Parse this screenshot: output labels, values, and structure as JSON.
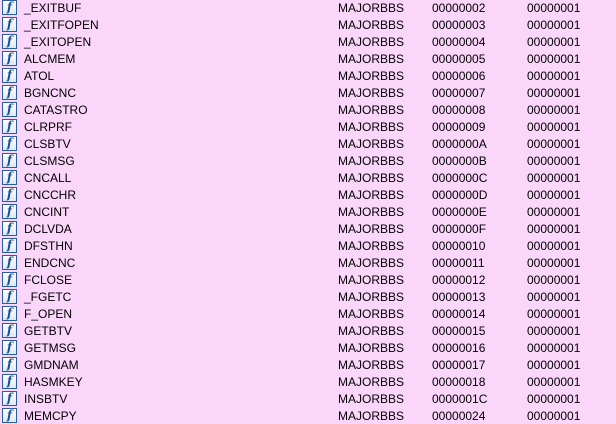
{
  "icon": {
    "name": "function-icon",
    "glyph": "f",
    "color": "#1f4f8f"
  },
  "rows": [
    {
      "name": "_EXITBUF",
      "module": "MAJORBBS",
      "ordinal": "00000002",
      "value": "00000001"
    },
    {
      "name": "_EXITFOPEN",
      "module": "MAJORBBS",
      "ordinal": "00000003",
      "value": "00000001"
    },
    {
      "name": "_EXITOPEN",
      "module": "MAJORBBS",
      "ordinal": "00000004",
      "value": "00000001"
    },
    {
      "name": "ALCMEM",
      "module": "MAJORBBS",
      "ordinal": "00000005",
      "value": "00000001"
    },
    {
      "name": "ATOL",
      "module": "MAJORBBS",
      "ordinal": "00000006",
      "value": "00000001"
    },
    {
      "name": "BGNCNC",
      "module": "MAJORBBS",
      "ordinal": "00000007",
      "value": "00000001"
    },
    {
      "name": "CATASTRO",
      "module": "MAJORBBS",
      "ordinal": "00000008",
      "value": "00000001"
    },
    {
      "name": "CLRPRF",
      "module": "MAJORBBS",
      "ordinal": "00000009",
      "value": "00000001"
    },
    {
      "name": "CLSBTV",
      "module": "MAJORBBS",
      "ordinal": "0000000A",
      "value": "00000001"
    },
    {
      "name": "CLSMSG",
      "module": "MAJORBBS",
      "ordinal": "0000000B",
      "value": "00000001"
    },
    {
      "name": "CNCALL",
      "module": "MAJORBBS",
      "ordinal": "0000000C",
      "value": "00000001"
    },
    {
      "name": "CNCCHR",
      "module": "MAJORBBS",
      "ordinal": "0000000D",
      "value": "00000001"
    },
    {
      "name": "CNCINT",
      "module": "MAJORBBS",
      "ordinal": "0000000E",
      "value": "00000001"
    },
    {
      "name": "DCLVDA",
      "module": "MAJORBBS",
      "ordinal": "0000000F",
      "value": "00000001"
    },
    {
      "name": "DFSTHN",
      "module": "MAJORBBS",
      "ordinal": "00000010",
      "value": "00000001"
    },
    {
      "name": "ENDCNC",
      "module": "MAJORBBS",
      "ordinal": "00000011",
      "value": "00000001"
    },
    {
      "name": "FCLOSE",
      "module": "MAJORBBS",
      "ordinal": "00000012",
      "value": "00000001"
    },
    {
      "name": "_FGETC",
      "module": "MAJORBBS",
      "ordinal": "00000013",
      "value": "00000001"
    },
    {
      "name": "F_OPEN",
      "module": "MAJORBBS",
      "ordinal": "00000014",
      "value": "00000001"
    },
    {
      "name": "GETBTV",
      "module": "MAJORBBS",
      "ordinal": "00000015",
      "value": "00000001"
    },
    {
      "name": "GETMSG",
      "module": "MAJORBBS",
      "ordinal": "00000016",
      "value": "00000001"
    },
    {
      "name": "GMDNAM",
      "module": "MAJORBBS",
      "ordinal": "00000017",
      "value": "00000001"
    },
    {
      "name": "HASMKEY",
      "module": "MAJORBBS",
      "ordinal": "00000018",
      "value": "00000001"
    },
    {
      "name": "INSBTV",
      "module": "MAJORBBS",
      "ordinal": "0000001C",
      "value": "00000001"
    },
    {
      "name": "MEMCPY",
      "module": "MAJORBBS",
      "ordinal": "00000024",
      "value": "00000001"
    }
  ]
}
